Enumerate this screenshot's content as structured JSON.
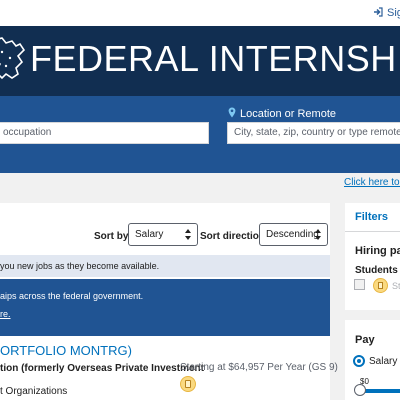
{
  "header": {
    "sign_in_label": "Sig",
    "site_title": "FEDERAL INTERNSHIP PO"
  },
  "search": {
    "keyword_placeholder": "occupation",
    "location_label": "Location or Remote",
    "location_placeholder": "City, state, zip, country or type remote"
  },
  "search_link": "Click here to se",
  "sort": {
    "sort_by_label": "Sort by",
    "sort_by_value": "Salary",
    "direction_label": "Sort direction",
    "direction_value": "Descending"
  },
  "alert_text": "you new jobs as they become available.",
  "info": {
    "line1": "aips across the federal government.",
    "line2": "re."
  },
  "job": {
    "title": "ORTFOLIO MONTRG)",
    "agency": "tion (formerly Overseas Private Investment",
    "salary": "Starting at $64,957 Per Year (GS 9)",
    "department": "t Organizations"
  },
  "filters": {
    "title": "Filters",
    "hiring_path_label": "Hiring pat",
    "students_label": "Students &",
    "students_item": "St",
    "pay_label": "Pay",
    "salary_option": "Salary",
    "salary_min": "$0"
  },
  "colors": {
    "navy": "#112e51",
    "blue": "#205493",
    "link": "#0071bc",
    "badge": "#fad980"
  },
  "icons": [
    "sign-in-icon",
    "us-map-icon",
    "location-pin-icon",
    "select-arrows-icon",
    "student-badge-icon"
  ]
}
